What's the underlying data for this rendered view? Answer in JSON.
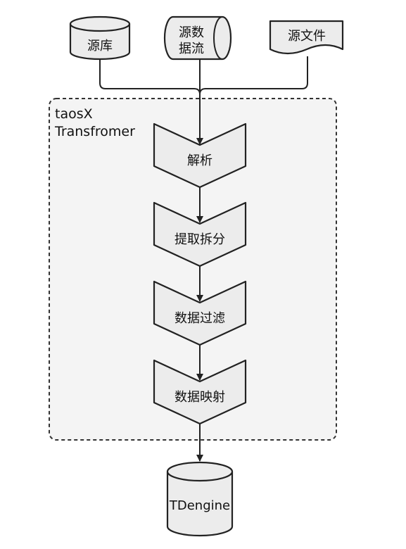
{
  "diagram": {
    "sources": {
      "database": "源库",
      "stream_line1": "源数",
      "stream_line2": "据流",
      "file": "源文件"
    },
    "region": {
      "line1": "taosX",
      "line2": "Transfromer"
    },
    "steps": [
      "解析",
      "提取拆分",
      "数据过滤",
      "数据映射"
    ],
    "sink": "TDengine"
  }
}
